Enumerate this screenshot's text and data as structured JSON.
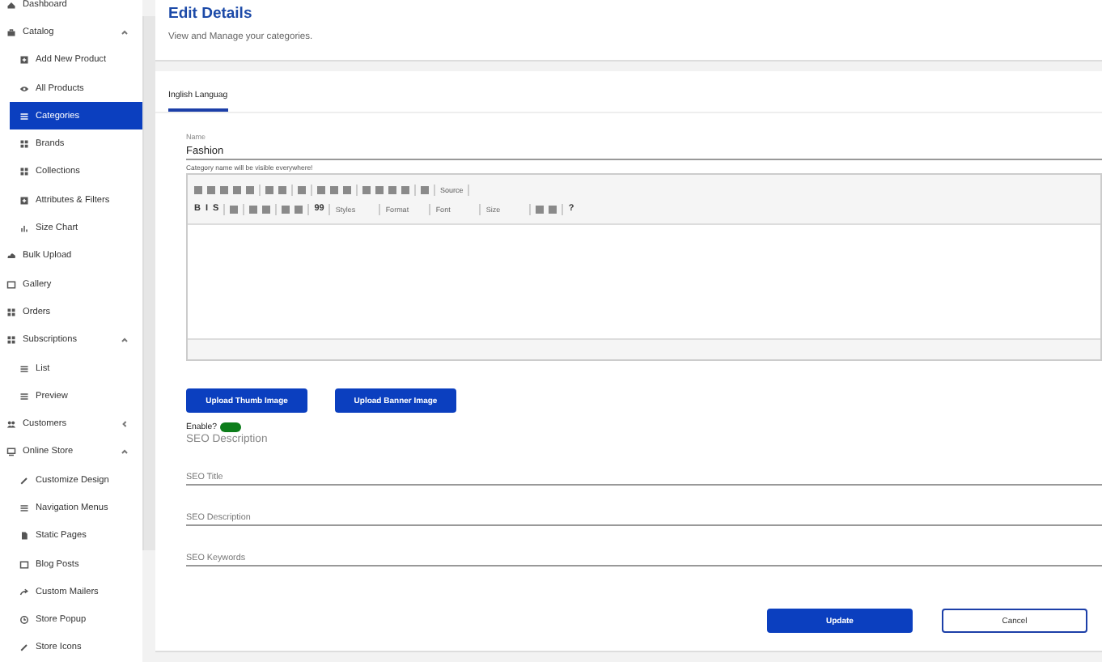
{
  "sidebar": {
    "items": [
      {
        "label": "Dashboard",
        "kind": "home",
        "selected": false
      },
      {
        "label": "Catalog",
        "kind": "bag",
        "selected": false,
        "expanded": true,
        "children": [
          {
            "label": "Add New Product",
            "kind": "plusbox",
            "selected": false
          },
          {
            "label": "All Products",
            "kind": "eye",
            "selected": false
          },
          {
            "label": "Categories",
            "kind": "list",
            "selected": true
          },
          {
            "label": "Brands",
            "kind": "grid",
            "selected": false
          },
          {
            "label": "Collections",
            "kind": "grid",
            "selected": false
          },
          {
            "label": "Attributes & Filters",
            "kind": "plusbox",
            "selected": false
          },
          {
            "label": "Size Chart",
            "kind": "bars",
            "selected": false
          }
        ]
      },
      {
        "label": "Bulk Upload",
        "kind": "cloud",
        "selected": false
      },
      {
        "label": "Gallery",
        "kind": "image",
        "selected": false
      },
      {
        "label": "Orders",
        "kind": "grid",
        "selected": false
      },
      {
        "label": "Subscriptions",
        "kind": "grid",
        "selected": false,
        "expanded": true,
        "children": [
          {
            "label": "List",
            "kind": "list",
            "selected": false
          },
          {
            "label": "Preview",
            "kind": "list",
            "selected": false
          }
        ]
      },
      {
        "label": "Customers",
        "kind": "people",
        "selected": false,
        "expanded": false
      },
      {
        "label": "Online Store",
        "kind": "monitor",
        "selected": false,
        "expanded": true,
        "children": [
          {
            "label": "Customize Design",
            "kind": "pencil",
            "selected": false
          },
          {
            "label": "Navigation Menus",
            "kind": "list",
            "selected": false
          },
          {
            "label": "Static Pages",
            "kind": "page",
            "selected": false
          },
          {
            "label": "Blog Posts",
            "kind": "image",
            "selected": false
          },
          {
            "label": "Custom Mailers",
            "kind": "share",
            "selected": false
          },
          {
            "label": "Store Popup",
            "kind": "clock",
            "selected": false
          },
          {
            "label": "Store Icons",
            "kind": "pencil",
            "selected": false
          }
        ]
      }
    ]
  },
  "header": {
    "title": "Edit Details",
    "subtitle": "View and Manage your categories."
  },
  "tabs": [
    {
      "label": "Inglish Languag",
      "selected": true
    }
  ],
  "name_field": {
    "label": "Name",
    "value": "Fashion",
    "helper": "Category name will be visible everywhere!"
  },
  "editor": {
    "toolbar_rows": [
      [
        {
          "kind": "icon"
        },
        {
          "kind": "icon"
        },
        {
          "kind": "icon"
        },
        {
          "kind": "icon"
        },
        {
          "kind": "icon"
        },
        {
          "kind": "sep"
        },
        {
          "kind": "icon"
        },
        {
          "kind": "icon"
        },
        {
          "kind": "sep"
        },
        {
          "kind": "icon"
        },
        {
          "kind": "sep"
        },
        {
          "kind": "icon"
        },
        {
          "kind": "icon"
        },
        {
          "kind": "icon"
        },
        {
          "kind": "sep"
        },
        {
          "kind": "icon"
        },
        {
          "kind": "icon"
        },
        {
          "kind": "icon"
        },
        {
          "kind": "icon"
        },
        {
          "kind": "sep"
        },
        {
          "kind": "icon"
        },
        {
          "kind": "sep"
        },
        {
          "kind": "button",
          "text": "Source"
        },
        {
          "kind": "sep"
        }
      ],
      [
        {
          "kind": "letter",
          "text": "B"
        },
        {
          "kind": "letter",
          "text": "I"
        },
        {
          "kind": "letter",
          "text": "S"
        },
        {
          "kind": "sep"
        },
        {
          "kind": "icon"
        },
        {
          "kind": "sep"
        },
        {
          "kind": "icon"
        },
        {
          "kind": "icon"
        },
        {
          "kind": "sep"
        },
        {
          "kind": "icon"
        },
        {
          "kind": "icon"
        },
        {
          "kind": "sep"
        },
        {
          "kind": "letter",
          "text": "99"
        },
        {
          "kind": "sep"
        },
        {
          "kind": "dropdown",
          "text": "Styles"
        },
        {
          "kind": "sep"
        },
        {
          "kind": "dropdown",
          "text": "Format"
        },
        {
          "kind": "sep"
        },
        {
          "kind": "dropdown",
          "text": "Font"
        },
        {
          "kind": "sep"
        },
        {
          "kind": "dropdown",
          "text": "Size"
        },
        {
          "kind": "sep"
        },
        {
          "kind": "icon"
        },
        {
          "kind": "icon"
        },
        {
          "kind": "sep"
        },
        {
          "kind": "letter",
          "text": "?"
        }
      ]
    ]
  },
  "upload_buttons": [
    "Upload Thumb Image",
    "Upload Banner Image"
  ],
  "enable": {
    "label": "Enable?",
    "on": true
  },
  "seo_heading": "SEO Description",
  "seo_fields": [
    {
      "placeholder": "SEO Title"
    },
    {
      "placeholder": "SEO Description"
    },
    {
      "placeholder": "SEO Keywords"
    }
  ],
  "actions": [
    {
      "label": "Update",
      "kind": "primary"
    },
    {
      "label": "Cancel",
      "kind": "secondary"
    }
  ]
}
